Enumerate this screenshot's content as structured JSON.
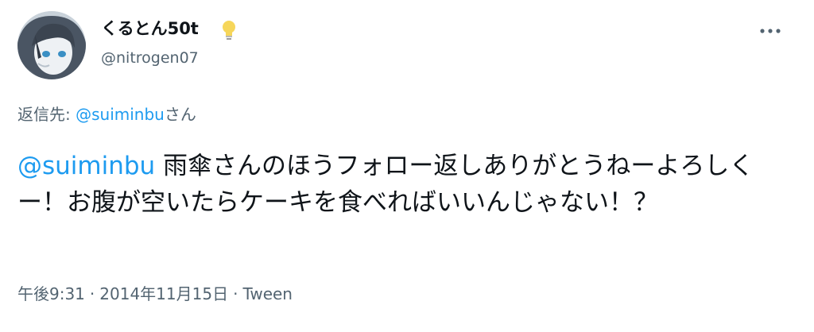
{
  "author": {
    "display_name": "くるとん50t",
    "badge_icon": "lightbulb-icon",
    "handle": "@nitrogen07",
    "avatar": "avatar-image"
  },
  "more_icon": "more-horizontal-icon",
  "reply": {
    "prefix": "返信先: ",
    "mention": "@suiminbu",
    "suffix": "さん"
  },
  "tweet": {
    "mention": "@suiminbu",
    "text": " 雨傘さんのほうフォロー返しありがとうねーよろしくー！お腹が空いたらケーキを食べればいいんじゃない！？"
  },
  "meta": {
    "time": "午後9:31",
    "separator": "·",
    "date": "2014年11月15日",
    "source": "Tween"
  },
  "colors": {
    "text": "#0f1419",
    "secondary": "#536471",
    "link": "#1d9bf0"
  }
}
